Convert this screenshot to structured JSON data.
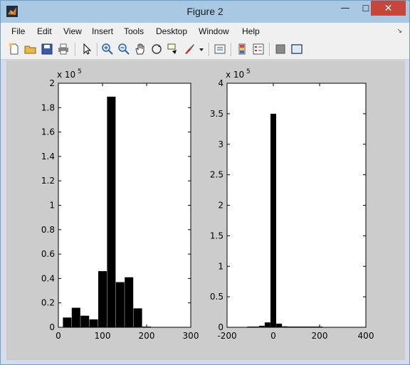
{
  "window": {
    "title": "Figure 2",
    "minimize_glyph": "—",
    "maximize_glyph": "☐",
    "close_glyph": "✕"
  },
  "menu": [
    "File",
    "Edit",
    "View",
    "Insert",
    "Tools",
    "Desktop",
    "Window",
    "Help"
  ],
  "toolbar": [
    "new-figure-icon",
    "open-file-icon",
    "save-icon",
    "print-icon",
    "pointer-icon",
    "zoom-in-icon",
    "zoom-out-icon",
    "pan-hand-icon",
    "rotate-3d-icon",
    "data-cursor-icon",
    "brush-icon",
    "brush-dropdown-icon",
    "link-plot-icon",
    "colorbar-icon",
    "legend-icon",
    "hide-plot-tools-icon",
    "show-plot-tools-icon"
  ],
  "colors": {
    "figure_bg": "#cccccc",
    "bar": "#000000",
    "axes_bg": "#ffffff",
    "title_bar": "#a9c8e4",
    "close_button": "#c7463b"
  },
  "chart_data": [
    {
      "type": "bar",
      "x": [
        20,
        40,
        60,
        80,
        100,
        120,
        140,
        160,
        180,
        200,
        220,
        240
      ],
      "values": [
        8000,
        16000,
        9500,
        6500,
        46000,
        189000,
        37000,
        41000,
        15500,
        500,
        0,
        0
      ],
      "exponent_label": "x 10",
      "exponent": "5",
      "xlim": [
        0,
        300
      ],
      "ylim": [
        0,
        200000
      ],
      "xticks": [
        "0",
        "100",
        "200",
        "300"
      ],
      "yticks": [
        "0",
        "0.2",
        "0.4",
        "0.6",
        "0.8",
        "1",
        "1.2",
        "1.4",
        "1.6",
        "1.8",
        "2"
      ]
    },
    {
      "type": "bar",
      "x": [
        -100,
        -75,
        -50,
        -25,
        0,
        25,
        50,
        75,
        100,
        125,
        150,
        175,
        200
      ],
      "values": [
        1000,
        1000,
        2500,
        8000,
        350000,
        6000,
        1500,
        1000,
        1000,
        1000,
        1000,
        1000,
        1000
      ],
      "exponent_label": "x 10",
      "exponent": "5",
      "xlim": [
        -200,
        400
      ],
      "ylim": [
        0,
        400000
      ],
      "xticks": [
        "-200",
        "0",
        "200",
        "400"
      ],
      "yticks": [
        "0",
        "0.5",
        "1",
        "1.5",
        "2",
        "2.5",
        "3",
        "3.5",
        "4"
      ]
    }
  ]
}
